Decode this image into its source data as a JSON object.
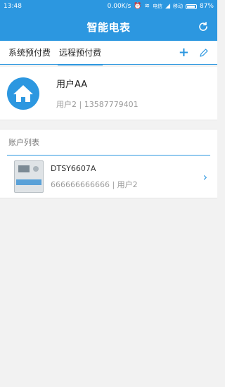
{
  "status_bar": {
    "time": "13:48",
    "speed": "0.00K/s",
    "carrier_1": "电信",
    "carrier_2": "移动",
    "battery": "87%",
    "icons": [
      "alarm-icon",
      "wifi-icon",
      "signal-icon"
    ]
  },
  "app_bar": {
    "title": "智能电表",
    "refresh_icon": "refresh-icon"
  },
  "tabs": [
    {
      "label": "系统预付费",
      "active": false
    },
    {
      "label": "远程预付费",
      "active": true
    }
  ],
  "tab_actions": {
    "add_icon": "plus-icon",
    "edit_icon": "pencil-icon"
  },
  "user": {
    "name": "用户AA",
    "subtitle": "用户2  |  13587779401",
    "avatar_icon": "house-icon"
  },
  "accounts": {
    "header": "账户列表",
    "items": [
      {
        "name": "DTSY6607A",
        "subtitle": "666666666666 | 用户2",
        "chevron": "›"
      }
    ]
  },
  "colors": {
    "accent": "#2c97e0",
    "background": "#f2f2f2"
  }
}
